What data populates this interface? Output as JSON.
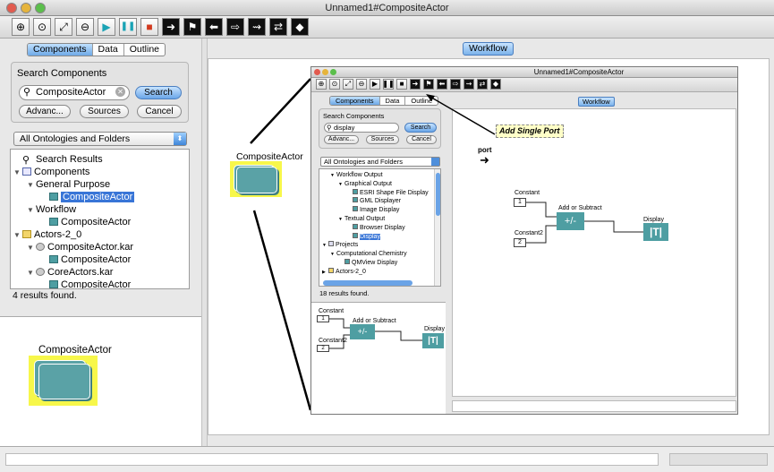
{
  "window": {
    "title": "Unnamed1#CompositeActor"
  },
  "toolbar": {
    "buttons": [
      {
        "name": "zoom-in-icon",
        "glyph": "⊕"
      },
      {
        "name": "zoom-reset-icon",
        "glyph": "⊙"
      },
      {
        "name": "zoom-fit-icon",
        "glyph": "⤢"
      },
      {
        "name": "zoom-out-icon",
        "glyph": "⊖"
      },
      {
        "name": "run-icon",
        "glyph": "▶"
      },
      {
        "name": "pause-icon",
        "glyph": "❚❚"
      },
      {
        "name": "stop-icon",
        "glyph": "■"
      },
      {
        "name": "output-port-icon",
        "glyph": "➜"
      },
      {
        "name": "input-port-icon",
        "glyph": "⚑"
      },
      {
        "name": "io-port-icon",
        "glyph": "⬅"
      },
      {
        "name": "multiport-icon",
        "glyph": "⇨"
      },
      {
        "name": "io-multiport-icon",
        "glyph": "⇝"
      },
      {
        "name": "relation-port-icon",
        "glyph": "⇄"
      },
      {
        "name": "diamond-relation-icon",
        "glyph": "◆"
      }
    ]
  },
  "left": {
    "tabs": [
      "Components",
      "Data",
      "Outline"
    ],
    "search_group_label": "Search Components",
    "search_value": "CompositeActor",
    "search_button": "Search",
    "advanced_button": "Advanc...",
    "sources_button": "Sources",
    "cancel_button": "Cancel",
    "ontology_select": "All Ontologies and Folders",
    "tree": [
      {
        "label": "Search Results",
        "icon": "search-icon",
        "indent": 0,
        "tri": ""
      },
      {
        "label": "Components",
        "icon": "book-icon",
        "indent": 0,
        "tri": "▼"
      },
      {
        "label": "General Purpose",
        "icon": "",
        "indent": 1,
        "tri": "▼"
      },
      {
        "label": "CompositeActor",
        "icon": "actor-icon",
        "indent": 2,
        "tri": "",
        "selected": true
      },
      {
        "label": "Workflow",
        "icon": "",
        "indent": 1,
        "tri": "▼"
      },
      {
        "label": "CompositeActor",
        "icon": "actor-icon",
        "indent": 2,
        "tri": ""
      },
      {
        "label": "Actors-2_0",
        "icon": "folder-icon",
        "indent": 0,
        "tri": "▼"
      },
      {
        "label": "CompositeActor.kar",
        "icon": "gear-icon",
        "indent": 1,
        "tri": "▼"
      },
      {
        "label": "CompositeActor",
        "icon": "actor-icon",
        "indent": 2,
        "tri": ""
      },
      {
        "label": "CoreActors.kar",
        "icon": "gear-icon",
        "indent": 1,
        "tri": "▼"
      },
      {
        "label": "CompositeActor",
        "icon": "actor-icon",
        "indent": 2,
        "tri": ""
      }
    ],
    "results_text": "4 results found.",
    "preview_label": "CompositeActor"
  },
  "workflow": {
    "tab": "Workflow",
    "canvas_actor_label": "CompositeActor",
    "inner": {
      "title": "Unnamed1#CompositeActor",
      "left_tabs": [
        "Components",
        "Data",
        "Outline"
      ],
      "search_group_label": "Search Components",
      "search_value": "display",
      "search_button": "Search",
      "advanced_button": "Advanc...",
      "sources_button": "Sources",
      "cancel_button": "Cancel",
      "ontology_select": "All Ontologies and Folders",
      "tree": [
        {
          "label": "Workflow Output",
          "indent": 1,
          "tri": "▼",
          "icon": ""
        },
        {
          "label": "Graphical Output",
          "indent": 2,
          "tri": "▼",
          "icon": ""
        },
        {
          "label": "ESRI Shape File Display",
          "indent": 3,
          "tri": "",
          "icon": "actor"
        },
        {
          "label": "GML Displayer",
          "indent": 3,
          "tri": "",
          "icon": "actor"
        },
        {
          "label": "Image Display",
          "indent": 3,
          "tri": "",
          "icon": "actor"
        },
        {
          "label": "Textual Output",
          "indent": 2,
          "tri": "▼",
          "icon": ""
        },
        {
          "label": "Browser Display",
          "indent": 3,
          "tri": "",
          "icon": "actor"
        },
        {
          "label": "Display",
          "indent": 3,
          "tri": "",
          "icon": "actor",
          "selected": true
        },
        {
          "label": "Projects",
          "indent": 0,
          "tri": "▼",
          "icon": "book"
        },
        {
          "label": "Computational Chemistry",
          "indent": 1,
          "tri": "▼",
          "icon": ""
        },
        {
          "label": "QMView Display",
          "indent": 2,
          "tri": "",
          "icon": "actor"
        },
        {
          "label": "Actors-2_0",
          "indent": 0,
          "tri": "▶",
          "icon": "folder"
        }
      ],
      "results_text": "18 results found.",
      "workflow_tab": "Workflow",
      "annotation": "Add Single Port",
      "port_label": "port",
      "const1_label": "Constant",
      "const1_value": "1",
      "const2_label": "Constant2",
      "const2_value": "2",
      "add_label": "Add or Subtract",
      "add_symbol": "+/-",
      "display_label": "Display",
      "display_symbol": "|T|"
    }
  }
}
